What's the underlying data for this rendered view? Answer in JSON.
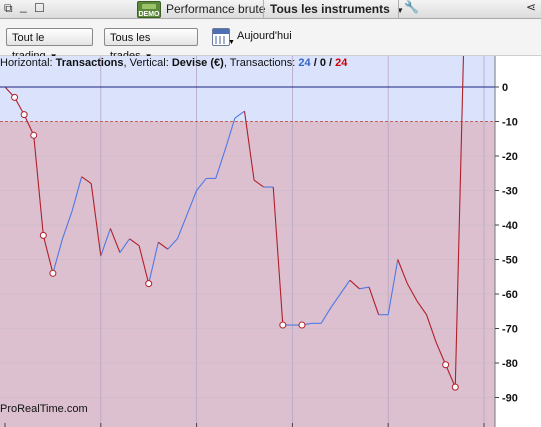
{
  "window": {
    "performance_label": "Performance brute",
    "instruments_label": "Tous les instruments",
    "demo_badge": "DEMO"
  },
  "toolbar": {
    "trading_dropdown": "Tout le trading",
    "trades_dropdown": "Tous les trades",
    "date_label": "Aujourd'hui"
  },
  "info_line": {
    "horizontal_key": "Horizontal:",
    "horizontal_value": "Transactions",
    "vertical_key": "Vertical:",
    "vertical_value": "Devise (€)",
    "transactions_key": "Transactions:",
    "count_positive": "24",
    "count_neutral": "0",
    "count_negative": "24"
  },
  "watermark": "ProRealTime.com",
  "colors": {
    "profit_zone": "#dbe3fc",
    "loss_zone": "#dcc0cf",
    "up_line": "#4e79e6",
    "down_line": "#b01f2a",
    "positive_count": "#3366cc",
    "negative_count": "#cc0000"
  },
  "chart_data": {
    "type": "line",
    "xlabel": "",
    "ylabel": "",
    "xlim": [
      0,
      50
    ],
    "ylim": [
      -95,
      8
    ],
    "x_ticks": [
      0,
      10,
      20,
      30,
      40,
      50
    ],
    "y_ticks": [
      0,
      -10,
      -20,
      -30,
      -40,
      -50,
      -60,
      -70,
      -80,
      -90
    ],
    "reference_line": 0,
    "drawdown_line": -10,
    "x": [
      0,
      1,
      2,
      3,
      4,
      5,
      6,
      7,
      8,
      9,
      10,
      11,
      12,
      13,
      14,
      15,
      16,
      17,
      18,
      19,
      20,
      21,
      22,
      23,
      24,
      25,
      26,
      27,
      28,
      29,
      30,
      31,
      32,
      33,
      34,
      35,
      36,
      37,
      38,
      39,
      40,
      41,
      42,
      43,
      44,
      45,
      46,
      47,
      48
    ],
    "values": [
      0,
      -3,
      -8,
      -14,
      -43,
      -54,
      -44,
      -36,
      -26,
      -28,
      -49,
      -41,
      -48,
      -44,
      -46,
      -57,
      -45,
      -47,
      -44,
      -37,
      -30,
      -26.5,
      -26.5,
      -18,
      -9,
      -7,
      -27,
      -29,
      -29,
      -69,
      -69,
      -69,
      -68.5,
      -68.5,
      -64,
      -60,
      -56,
      -58.5,
      -58,
      -66,
      -66,
      -50,
      -57,
      -62,
      -66,
      -74,
      -80.5,
      -87
    ],
    "markers_x": [
      1,
      2,
      3,
      4,
      5,
      15,
      29,
      31,
      46,
      47,
      48
    ]
  }
}
